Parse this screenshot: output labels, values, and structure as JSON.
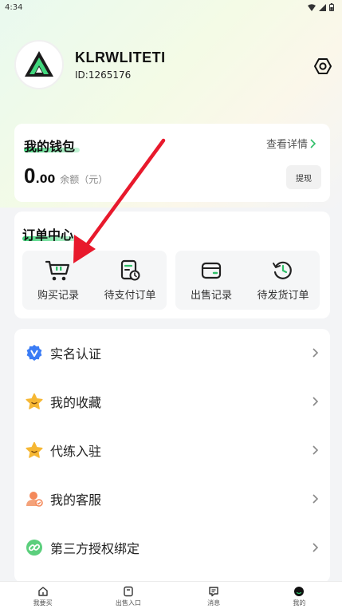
{
  "status": {
    "time": "4:34"
  },
  "profile": {
    "name": "KLRWLITETI",
    "id_text": "ID:1265176"
  },
  "wallet": {
    "title": "我的钱包",
    "detail_link": "查看详情",
    "balance_int": "0",
    "balance_dec": ".00",
    "balance_label": "余额（元）",
    "withdraw_label": "提现"
  },
  "orders": {
    "title": "订单中心",
    "items": [
      {
        "label": "购买记录",
        "icon": "cart-icon"
      },
      {
        "label": "待支付订单",
        "icon": "pending-payment-icon"
      },
      {
        "label": "出售记录",
        "icon": "wallet-icon"
      },
      {
        "label": "待发货订单",
        "icon": "history-icon"
      }
    ]
  },
  "menu": {
    "items": [
      {
        "label": "实名认证",
        "icon": "verified-badge-icon",
        "color": "#3b7cf5"
      },
      {
        "label": "我的收藏",
        "icon": "star-icon",
        "color": "#f6b733"
      },
      {
        "label": "代练入驻",
        "icon": "star-icon",
        "color": "#f6b733"
      },
      {
        "label": "我的客服",
        "icon": "customer-service-icon",
        "color": "#f4895a"
      },
      {
        "label": "第三方授权绑定",
        "icon": "link-icon",
        "color": "#5ccf7d"
      }
    ]
  },
  "tabbar": {
    "tabs": [
      {
        "label": "我要买",
        "icon": "home-icon"
      },
      {
        "label": "出售入口",
        "icon": "sell-icon"
      },
      {
        "label": "消息",
        "icon": "message-icon"
      },
      {
        "label": "我的",
        "icon": "profile-icon"
      }
    ]
  },
  "colors": {
    "accent": "#2fbf68",
    "annotation_arrow": "#e8192c"
  }
}
